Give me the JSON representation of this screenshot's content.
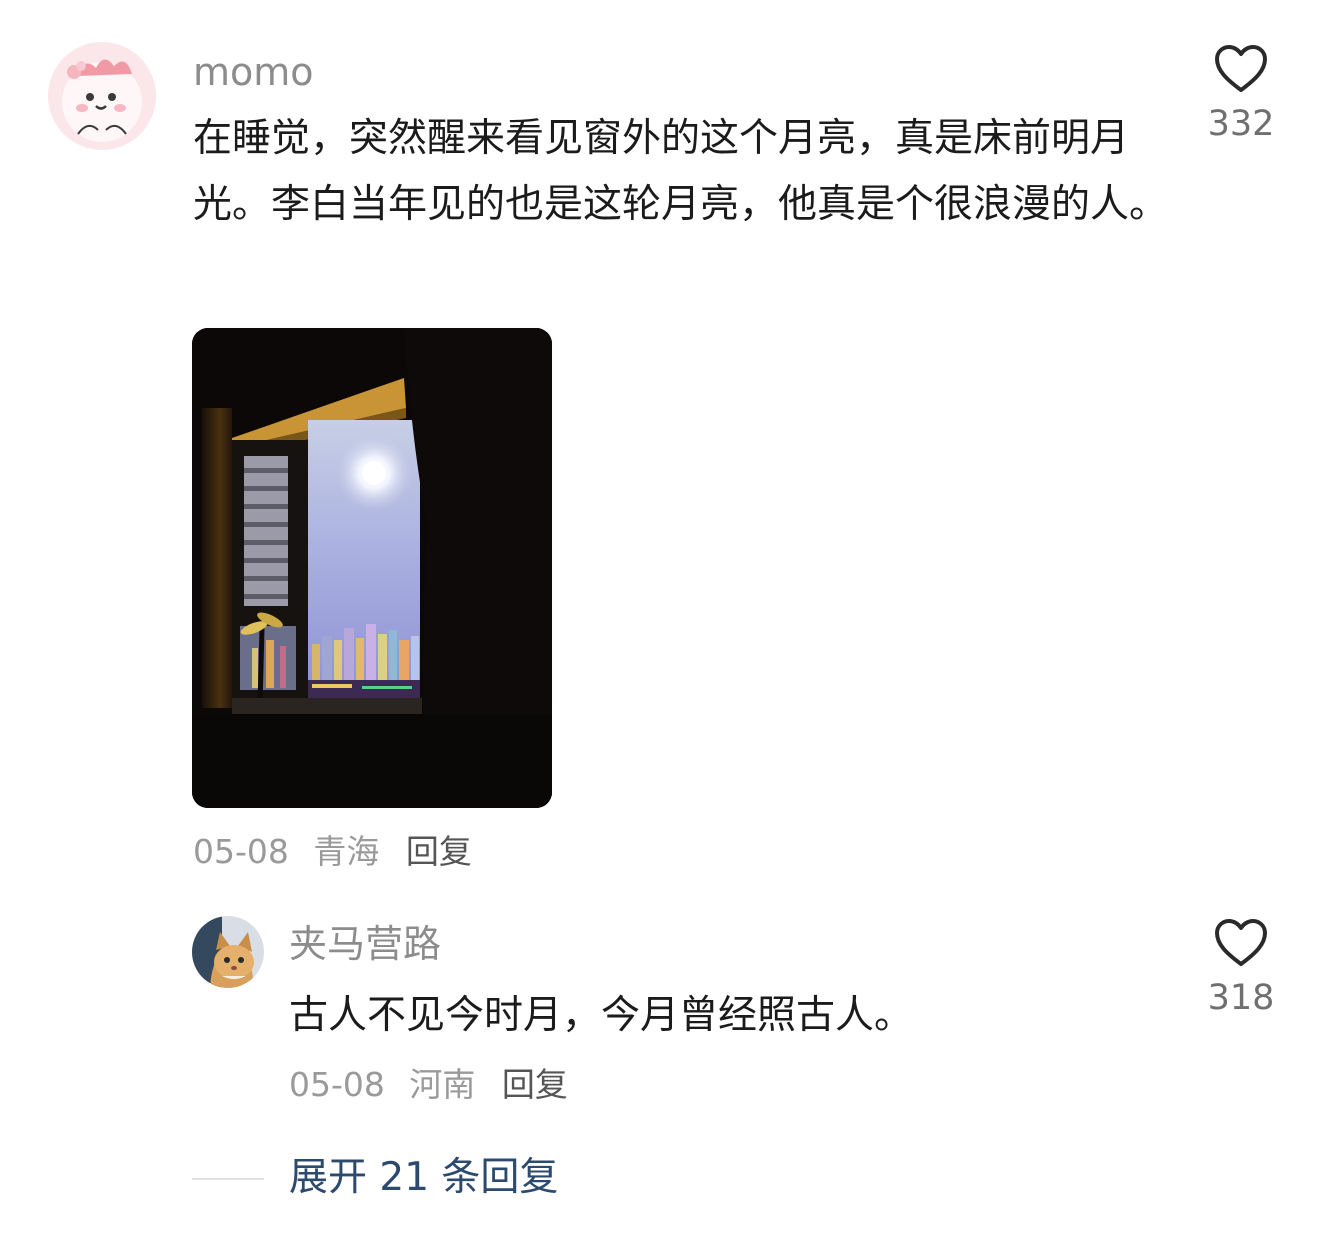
{
  "main_comment": {
    "username": "momo",
    "text": "在睡觉，突然醒来看见窗外的这个月亮，真是床前明月光。李白当年见的也是这轮月亮，他真是个很浪漫的人。",
    "date": "05-08",
    "location": "青海",
    "reply_label": "回复",
    "like_count": "332",
    "avatar_icon": "cartoon-avatar-icon",
    "photo_subject": "night-window-moon-photo"
  },
  "reply_comment": {
    "username": "夹马营路",
    "text": "古人不见今时月，今月曾经照古人。",
    "date": "05-08",
    "location": "河南",
    "reply_label": "回复",
    "like_count": "318",
    "avatar_icon": "cat-avatar-icon"
  },
  "expand": {
    "label": "展开 21 条回复"
  },
  "colors": {
    "username": "#8c8c8c",
    "meta": "#9a9a9a",
    "reply_link": "#555555",
    "expand_link": "#2c4a6e",
    "heart_outline": "#2a2a2a",
    "avatar_pink": "#fbe3e8"
  }
}
